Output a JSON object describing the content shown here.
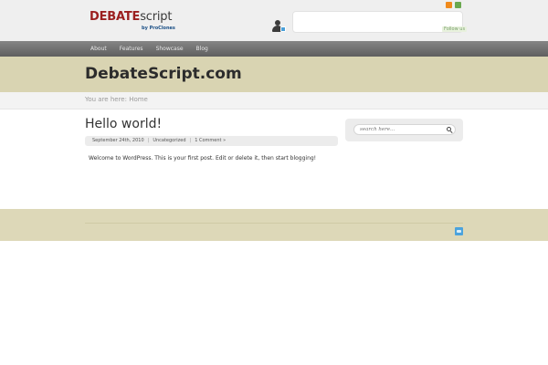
{
  "header": {
    "logo": {
      "main_bold": "DEBATE",
      "main_light": "script",
      "sub": "by ProClones"
    },
    "follow_label": "Follow us",
    "rss_icon": "rss-icon",
    "mail_icon": "mail-icon",
    "user_icon": "user-icon"
  },
  "nav": {
    "items": [
      {
        "label": "About"
      },
      {
        "label": "Features"
      },
      {
        "label": "Showcase"
      },
      {
        "label": "Blog"
      }
    ]
  },
  "site": {
    "title": "DebateScript.com"
  },
  "breadcrumb": {
    "text": "You are here: Home"
  },
  "post": {
    "title": "Hello world!",
    "date": "September 24th, 2010",
    "category": "Uncategorized",
    "comments": "1 Comment »",
    "body": "Welcome to WordPress. This is your first post. Edit or delete it, then start blogging!"
  },
  "sidebar": {
    "search_placeholder": "search here..."
  },
  "footer": {
    "icon": "twitter-icon"
  },
  "colors": {
    "title_band": "#d9d4b2",
    "footer_band": "#ddd8b8",
    "nav": "#6f6f6f",
    "logo_accent": "#9b1f1f"
  }
}
